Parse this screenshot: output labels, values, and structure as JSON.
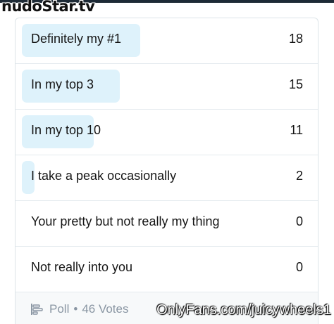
{
  "watermark_top": {
    "main": "nudoStar",
    "suffix": ".tv"
  },
  "poll": {
    "options": [
      {
        "label": "Definitely my #1",
        "count": "18",
        "fraction": 1.0
      },
      {
        "label": "In my top 3",
        "count": "15",
        "fraction": 0.83
      },
      {
        "label": "In my top 10",
        "count": "11",
        "fraction": 0.61
      },
      {
        "label": "I take a peak occasionally",
        "count": "2",
        "fraction": 0.11
      },
      {
        "label": "Your pretty but not really my thing",
        "count": "0",
        "fraction": 0
      },
      {
        "label": "Not really into you",
        "count": "0",
        "fraction": 0
      }
    ],
    "footer": {
      "icon": "poll-icon",
      "type_label": "Poll",
      "separator": "•",
      "votes_label": "46 Votes"
    }
  },
  "watermark_bottom": "OnlyFans.com/juicywheels1",
  "colors": {
    "bar_fill": "#def2fb",
    "text": "#151515",
    "muted": "#8a96a3",
    "footer_bg": "#f7f9fa"
  }
}
